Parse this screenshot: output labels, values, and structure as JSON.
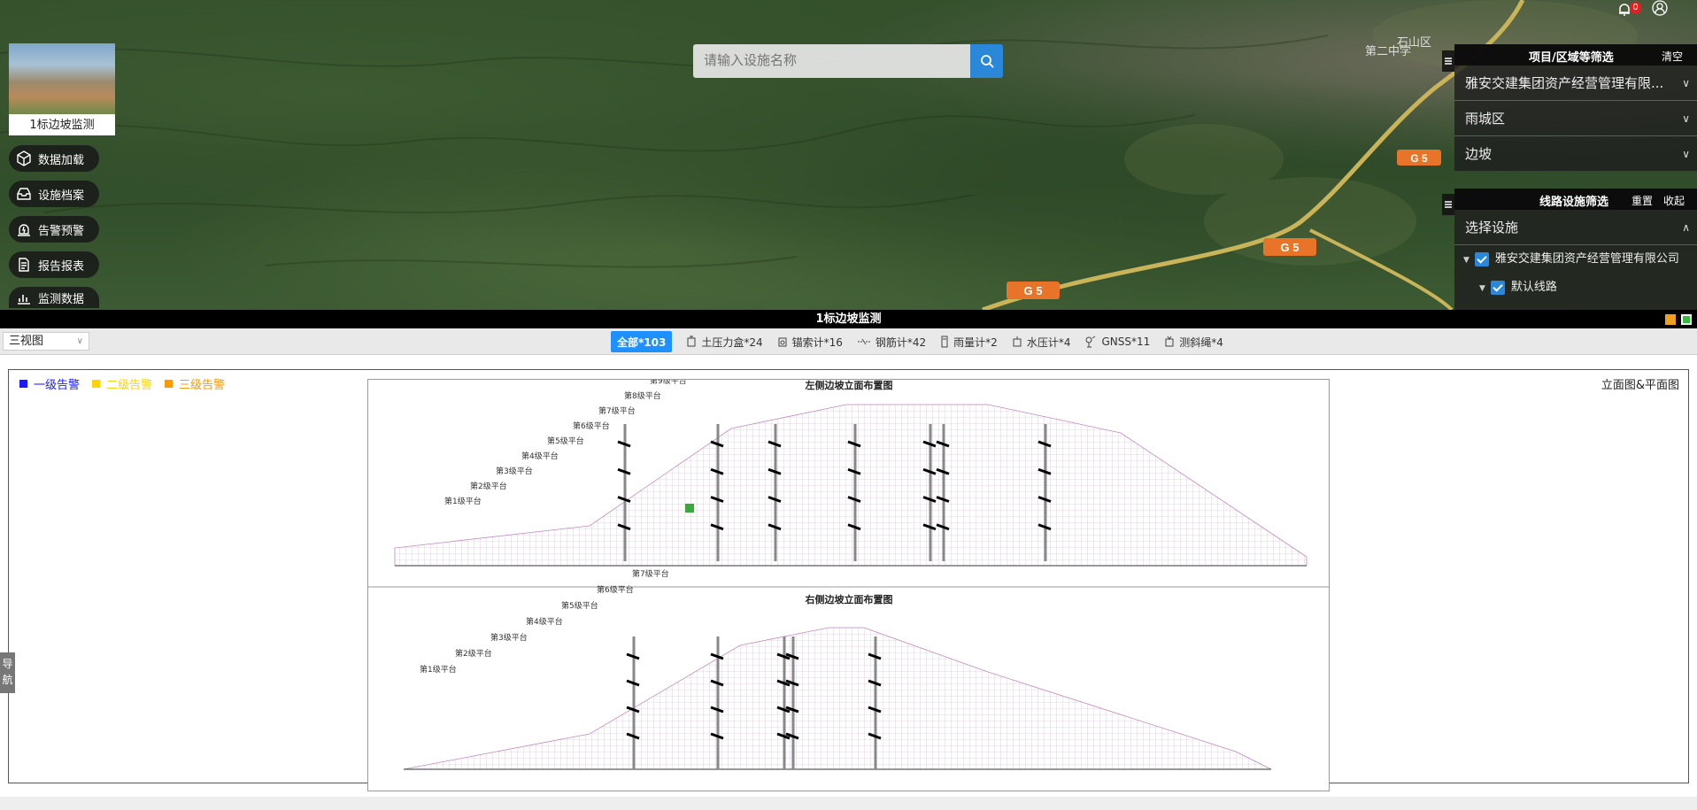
{
  "map": {
    "place_labels": [
      "石山区",
      "第二中学",
      "G 5",
      "G 5",
      "G 5"
    ],
    "thumbnail_caption": "1标边坡监测",
    "menu": [
      {
        "label": "数据加载",
        "icon": "cube-icon"
      },
      {
        "label": "设施档案",
        "icon": "inbox-icon"
      },
      {
        "label": "告警预警",
        "icon": "alarm-icon"
      },
      {
        "label": "报告报表",
        "icon": "document-icon"
      },
      {
        "label": "监测数据",
        "icon": "chart-icon"
      }
    ],
    "search": {
      "placeholder": "请输入设施名称"
    },
    "notification_count": "0"
  },
  "filter_panel": {
    "title": "项目/区域等筛选",
    "clear_label": "清空",
    "rows": [
      "雅安交建集团资产经营管理有限...",
      "雨城区",
      "边坡"
    ]
  },
  "line_panel": {
    "title": "线路设施筛选",
    "reset_label": "重置",
    "collapse_label": "收起",
    "select_label": "选择设施",
    "tree": [
      {
        "label": "雅安交建集团资产经营管理有限公司",
        "level": 0
      },
      {
        "label": "默认线路",
        "level": 1
      }
    ]
  },
  "viewer": {
    "title": "1标边坡监测",
    "view_select": "三视图",
    "filters": [
      {
        "label": "全部*103",
        "active": true,
        "icon": ""
      },
      {
        "label": "土压力盒*24",
        "active": false,
        "icon": "pressure-cell-icon"
      },
      {
        "label": "锚索计*16",
        "active": false,
        "icon": "anchor-meter-icon"
      },
      {
        "label": "钢筋计*42",
        "active": false,
        "icon": "rebar-meter-icon"
      },
      {
        "label": "雨量计*2",
        "active": false,
        "icon": "rain-gauge-icon"
      },
      {
        "label": "水压计*4",
        "active": false,
        "icon": "water-pressure-icon"
      },
      {
        "label": "GNSS*11",
        "active": false,
        "icon": "gnss-icon"
      },
      {
        "label": "测斜绳*4",
        "active": false,
        "icon": "inclinometer-icon"
      }
    ],
    "legend": [
      {
        "label": "一级告警",
        "color": "#1a1aff"
      },
      {
        "label": "二级告警",
        "color": "#ffd400"
      },
      {
        "label": "三级告警",
        "color": "#ff9900"
      }
    ],
    "view_name": "立面图&平面图",
    "nav_label": "导航",
    "drawing": {
      "left_title": "左侧边坡立面布置图",
      "right_title": "右侧边坡立面布置图",
      "left_platforms": [
        "第1级平台",
        "第2级平台",
        "第3级平台",
        "第4级平台",
        "第5级平台",
        "第6级平台",
        "第7级平台",
        "第8级平台",
        "第9级平台"
      ],
      "right_platforms": [
        "第1级平台",
        "第2级平台",
        "第3级平台",
        "第4级平台",
        "第5级平台",
        "第6级平台",
        "第7级平台"
      ]
    }
  }
}
